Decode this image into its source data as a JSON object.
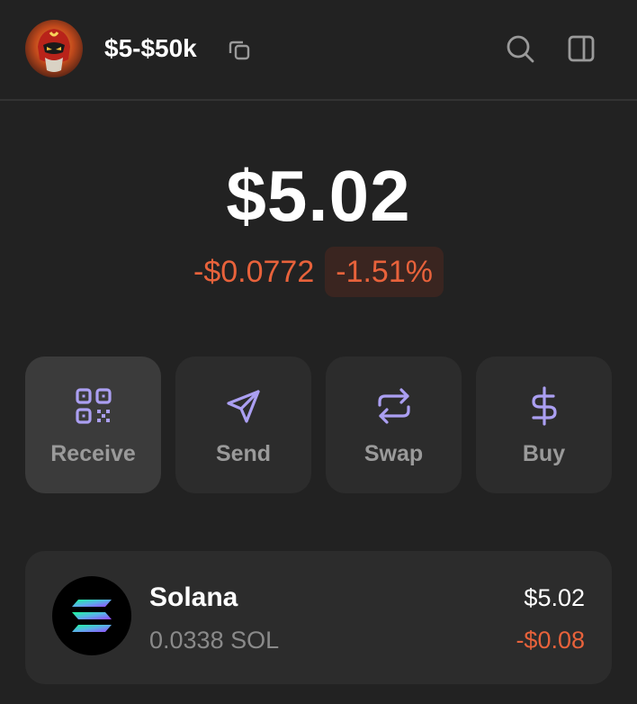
{
  "header": {
    "account_name": "$5-$50k"
  },
  "balance": {
    "total": "$5.02",
    "change_value": "-$0.0772",
    "change_percent": "-1.51%"
  },
  "actions": [
    {
      "label": "Receive",
      "icon": "qr-code-icon"
    },
    {
      "label": "Send",
      "icon": "send-icon"
    },
    {
      "label": "Swap",
      "icon": "swap-icon"
    },
    {
      "label": "Buy",
      "icon": "dollar-icon"
    }
  ],
  "tokens": [
    {
      "name": "Solana",
      "amount": "0.0338 SOL",
      "value": "$5.02",
      "change": "-$0.08"
    }
  ],
  "colors": {
    "background": "#222222",
    "card": "#2c2c2c",
    "accent": "#ab9ff2",
    "negative": "#e8623b"
  }
}
